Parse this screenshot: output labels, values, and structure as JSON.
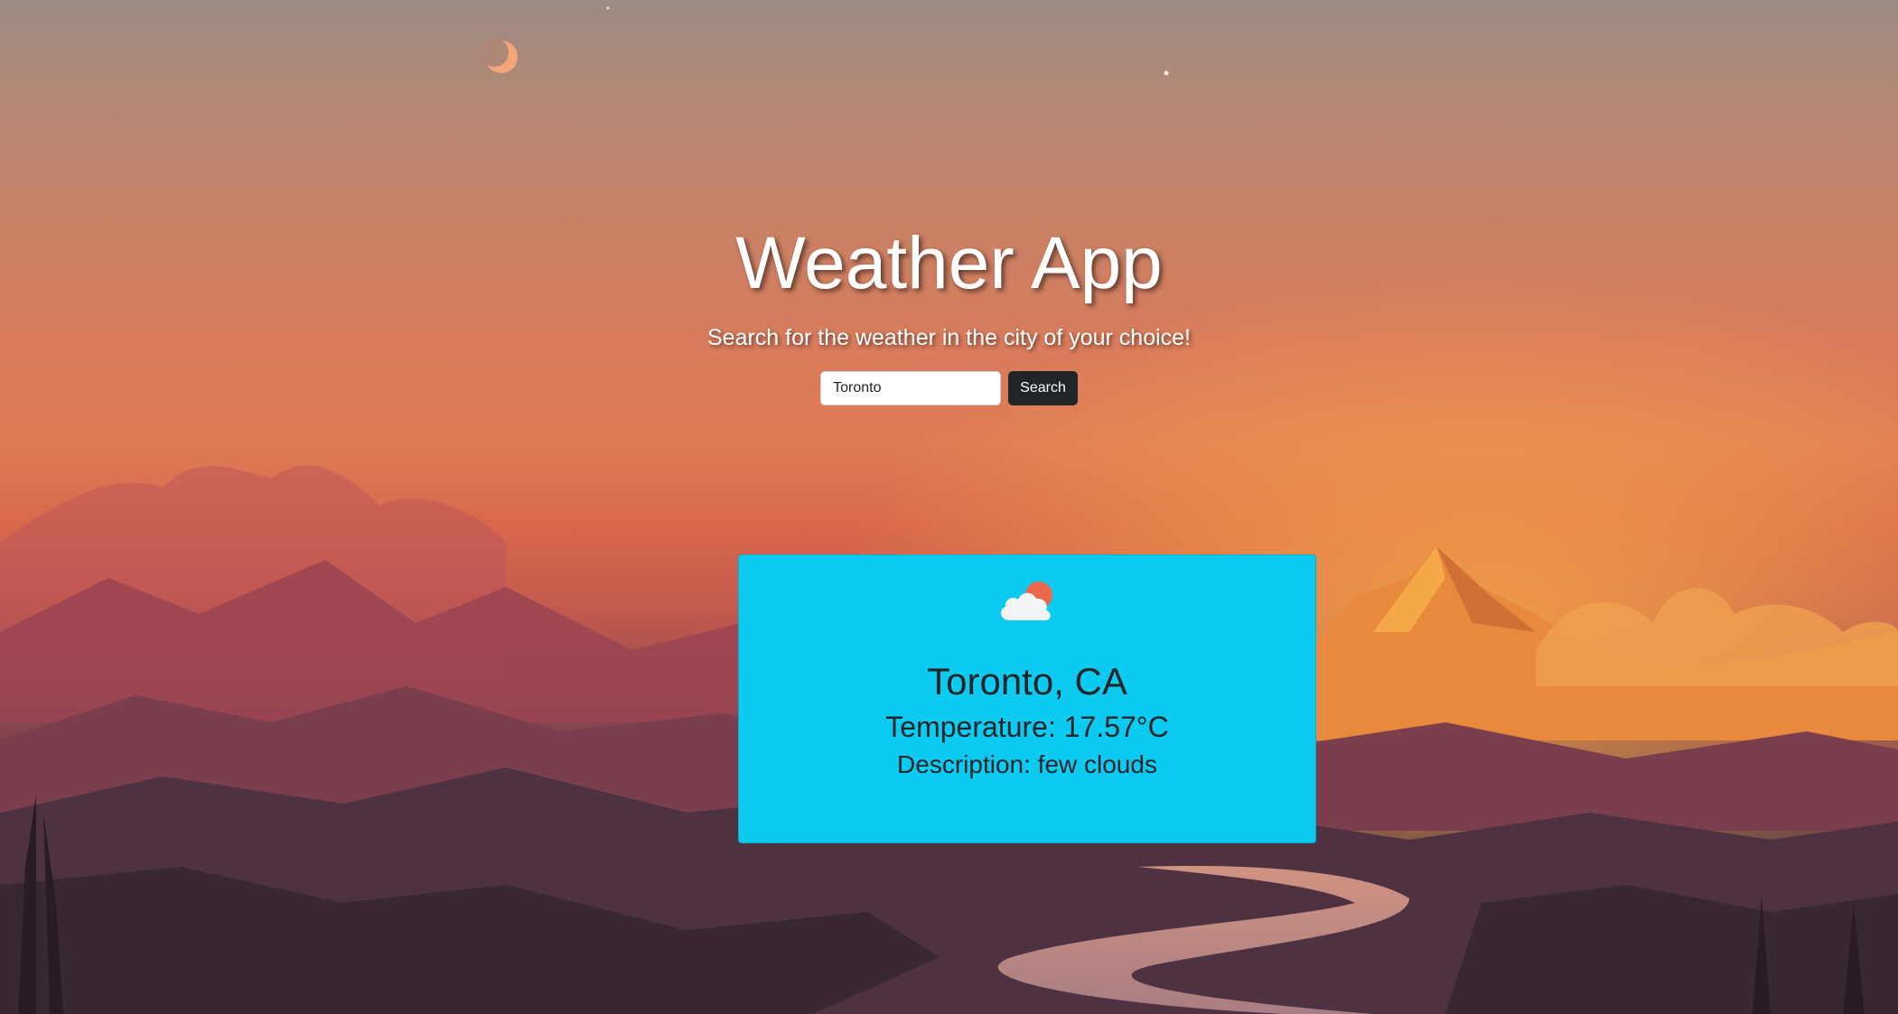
{
  "page": {
    "title": "Weather App",
    "subtitle": "Search for the weather in the city of your choice!"
  },
  "search": {
    "value": "Toronto",
    "placeholder": "",
    "button_label": "Search"
  },
  "weather": {
    "icon": "few-clouds-icon",
    "city": "Toronto, CA",
    "temperature": "Temperature: 17.57°C",
    "description": "Description: few clouds"
  },
  "colors": {
    "card_background": "#0dcaf0",
    "button_background": "#212529",
    "title_text": "#ffffff"
  }
}
